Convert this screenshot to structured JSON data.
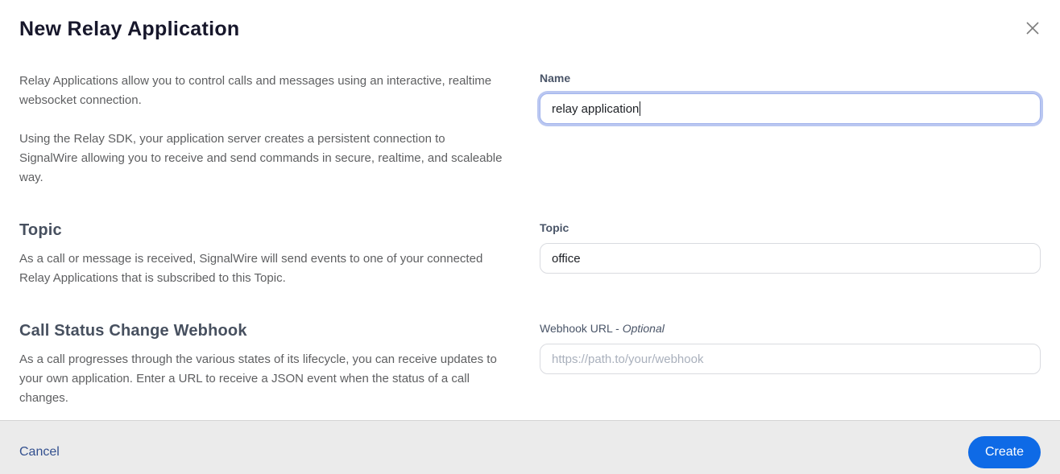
{
  "modal": {
    "title": "New Relay Application"
  },
  "sections": {
    "intro": {
      "p1": "Relay Applications allow you to control calls and messages using an interactive, realtime websocket connection.",
      "p2": "Using the Relay SDK, your application server creates a persistent connection to SignalWire allowing you to receive and send commands in secure, realtime, and scaleable way."
    },
    "topic": {
      "heading": "Topic",
      "description": "As a call or message is received, SignalWire will send events to one of your connected Relay Applications that is subscribed to this Topic."
    },
    "call_status_webhook": {
      "heading": "Call Status Change Webhook",
      "description": "As a call progresses through the various states of its lifecycle, you can receive updates to your own application. Enter a URL to receive a JSON event when the status of a call changes."
    }
  },
  "form": {
    "name": {
      "label": "Name",
      "value": "relay application"
    },
    "topic": {
      "label": "Topic",
      "value": "office"
    },
    "webhook_url": {
      "label_prefix": "Webhook URL - ",
      "label_optional": "Optional",
      "placeholder": "https://path.to/your/webhook",
      "value": ""
    }
  },
  "footer": {
    "cancel_label": "Cancel",
    "create_label": "Create"
  },
  "icons": {
    "close": "x-close"
  },
  "colors": {
    "accent_blue": "#0e6ae6",
    "cancel_link": "#33508f",
    "focus_ring": "#bac7f1",
    "footer_bg": "#ebebeb",
    "heading_slate": "#47505f",
    "body_gray": "#5e5f61",
    "title_dark": "#17172b"
  }
}
